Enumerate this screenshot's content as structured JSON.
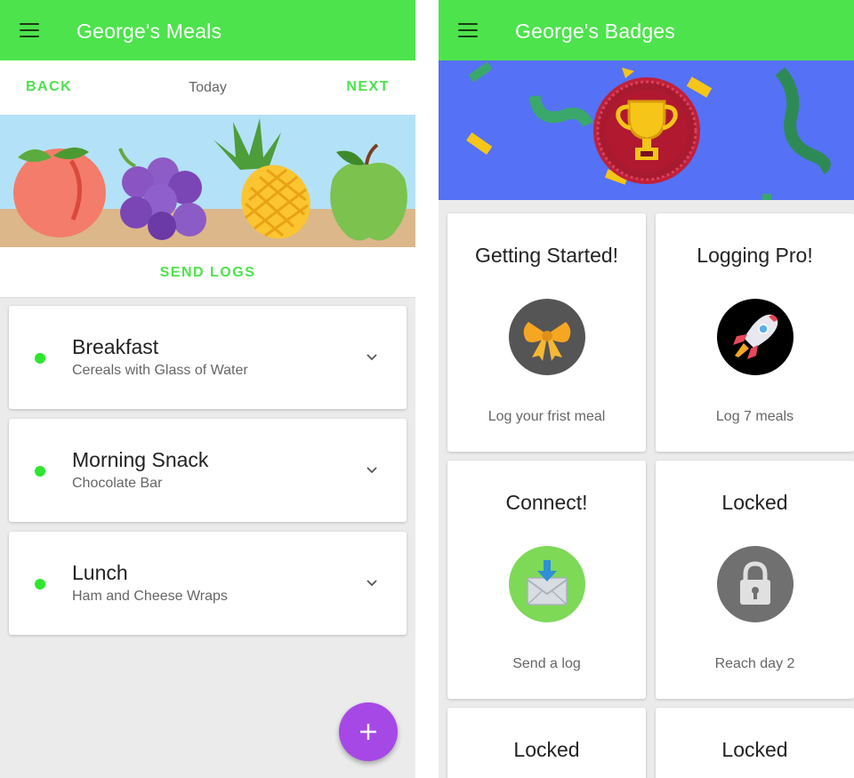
{
  "meals_screen": {
    "title": "George's Meals",
    "nav": {
      "back_label": "BACK",
      "date_label": "Today",
      "next_label": "NEXT"
    },
    "send_logs_label": "SEND LOGS",
    "meals": [
      {
        "name": "Breakfast",
        "description": "Cereals with Glass of Water"
      },
      {
        "name": "Morning Snack",
        "description": "Chocolate Bar"
      },
      {
        "name": "Lunch",
        "description": "Ham and Cheese Wraps"
      }
    ],
    "fab_icon": "plus-icon"
  },
  "badges_screen": {
    "title": "George's Badges",
    "hero_icon": "trophy-icon",
    "badges": [
      {
        "title": "Getting Started!",
        "icon": "bow-icon",
        "description": "Log your frist meal"
      },
      {
        "title": "Logging Pro!",
        "icon": "rocket-icon",
        "description": "Log 7 meals"
      },
      {
        "title": "Connect!",
        "icon": "envelope-icon",
        "description": "Send a log"
      },
      {
        "title": "Locked",
        "icon": "lock-icon",
        "description": "Reach day 2"
      },
      {
        "title": "Locked"
      },
      {
        "title": "Locked"
      }
    ]
  },
  "colors": {
    "app_bar": "#4de34c",
    "accent": "#4de34c",
    "status_dot": "#2ee62e",
    "fab": "#a648e6",
    "hero_background": "#5571f5"
  }
}
